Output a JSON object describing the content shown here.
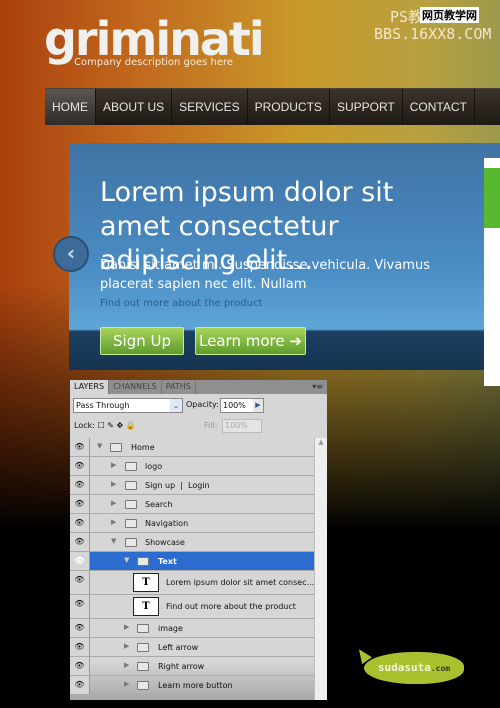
{
  "header": {
    "logo": "griminati",
    "tagline": "Company description goes here",
    "watermark_line1": "PS教程论坛",
    "watermark_line2": "BBS.16XX8.COM",
    "watermark_badge": "网页教学网"
  },
  "nav": {
    "items": [
      "HOME",
      "ABOUT US",
      "SERVICES",
      "PRODUCTS",
      "SUPPORT",
      "CONTACT"
    ],
    "active": "HOME"
  },
  "showcase": {
    "headline": "Lorem ipsum dolor sit amet consectetur adipiscing elit...",
    "body": "Danisi sit amet mi. Suspendisse vehicula. Vivamus placerat sapien nec elit. Nullam",
    "link": "Find out more about the product",
    "signup": "Sign Up",
    "learn_more": "Learn more",
    "learn_more_icon": "➔",
    "prev_icon": "‹"
  },
  "layers_panel": {
    "tabs": [
      "LAYERS",
      "CHANNELS",
      "PATHS"
    ],
    "menu_icon": "▾≡",
    "blend_mode": "Pass Through",
    "opacity_label": "Opacity:",
    "opacity": "100%",
    "lock_label": "Lock:",
    "lock_icons": "☐ ✎ ✥ 🔒",
    "fill_label": "Fill:",
    "fill": "100%",
    "layers": [
      {
        "name": "Home",
        "type": "group",
        "expanded": true
      },
      {
        "name": "logo",
        "type": "group"
      },
      {
        "name": "Sign up  |  Login",
        "type": "group"
      },
      {
        "name": "Search",
        "type": "group"
      },
      {
        "name": "Navigation",
        "type": "group"
      },
      {
        "name": "Showcase",
        "type": "group",
        "expanded": true
      },
      {
        "name": "Text",
        "type": "group",
        "expanded": true,
        "selected": true
      },
      {
        "name": "Lorem ipsum dolor sit amet consec...",
        "type": "text"
      },
      {
        "name": "Find out more about the product",
        "type": "text"
      },
      {
        "name": "image",
        "type": "group"
      },
      {
        "name": "Left arrow",
        "type": "group"
      },
      {
        "name": "Right arrow",
        "type": "group"
      },
      {
        "name": "Learn more button",
        "type": "group"
      }
    ]
  },
  "badge": {
    "text": "sudasuta",
    ".com": ".com"
  },
  "colors": {
    "accent_green": "#a9c12e",
    "selection": "#2d6ccf",
    "showcase_blue": "#4a8cc4"
  }
}
